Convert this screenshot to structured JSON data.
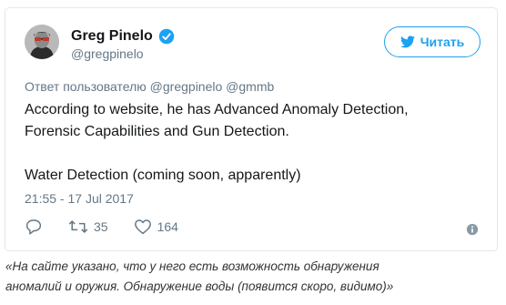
{
  "tweet": {
    "author_name": "Greg Pinelo",
    "author_handle": "@gregpinelo",
    "follow_label": "Читать",
    "reply_to": "Ответ пользователю @gregpinelo @gmmb",
    "body_lines": [
      "According to website, he has Advanced Anomaly Detection,",
      "Forensic Capabilities and Gun Detection.",
      "",
      "Water Detection (coming soon, apparently)"
    ],
    "timestamp": "21:55 - 17 Jul 2017",
    "retweets": "35",
    "likes": "164"
  },
  "caption_lines": [
    "«На сайте указано, что у него есть возможность обнаружения",
    "аномалий и оружия. Обнаружение воды (появится скоро, видимо)»"
  ],
  "colors": {
    "accent": "#1da1f2",
    "muted": "#657786",
    "border": "#e1e8ed"
  },
  "icons": [
    "verified-badge-icon",
    "twitter-bird-icon",
    "reply-icon",
    "retweet-icon",
    "like-heart-icon",
    "info-icon"
  ]
}
